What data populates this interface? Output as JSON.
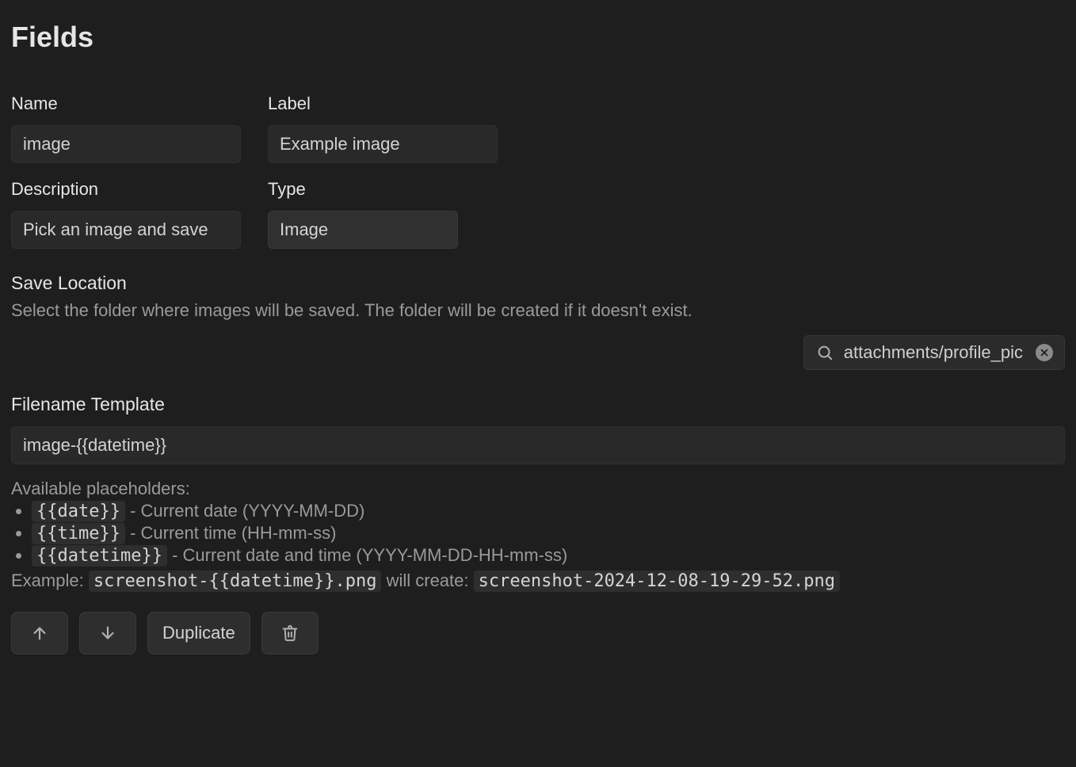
{
  "page": {
    "title": "Fields"
  },
  "labels": {
    "name": "Name",
    "label": "Label",
    "description": "Description",
    "type": "Type",
    "save_location": "Save Location",
    "save_location_help": "Select the folder where images will be saved. The folder will be created if it doesn't exist.",
    "filename_template": "Filename Template",
    "available_placeholders": "Available placeholders:",
    "example_prefix": "Example: ",
    "example_middle": " will create: "
  },
  "values": {
    "name": "image",
    "label": "Example image",
    "description": "Pick an image and save",
    "type": "Image",
    "save_location": "attachments/profile_pic",
    "filename_template": "image-{{datetime}}"
  },
  "placeholders": [
    {
      "token": "{{date}}",
      "desc": " - Current date (YYYY-MM-DD)"
    },
    {
      "token": "{{time}}",
      "desc": " - Current time (HH-mm-ss)"
    },
    {
      "token": "{{datetime}}",
      "desc": " - Current date and time (YYYY-MM-DD-HH-mm-ss)"
    }
  ],
  "example": {
    "template": "screenshot-{{datetime}}.png",
    "result": "screenshot-2024-12-08-19-29-52.png"
  },
  "buttons": {
    "duplicate": "Duplicate"
  }
}
